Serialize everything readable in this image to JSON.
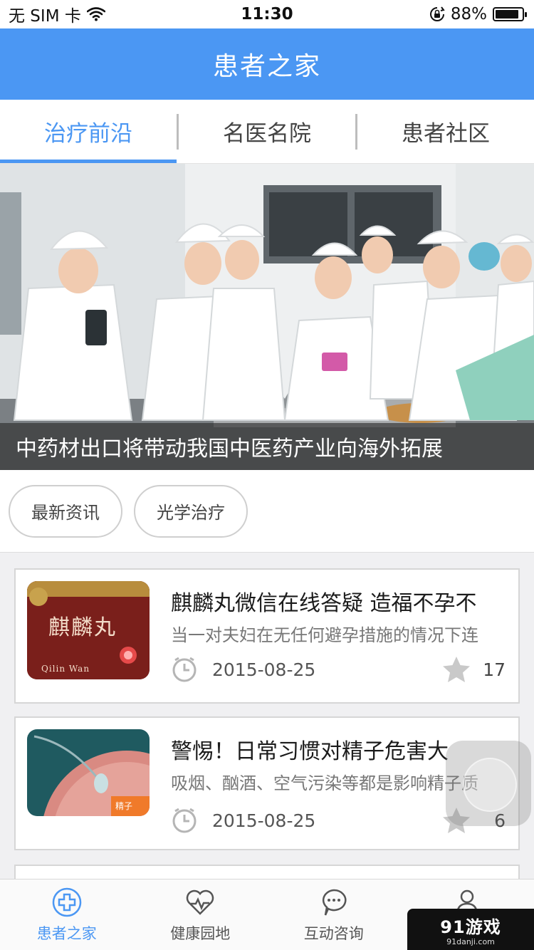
{
  "status_bar": {
    "carrier": "无 SIM 卡",
    "time": "11:30",
    "battery": "88%",
    "battery_level": 0.88
  },
  "nav": {
    "title": "患者之家"
  },
  "tabs": [
    {
      "label": "治疗前沿",
      "active": true
    },
    {
      "label": "名医名院",
      "active": false
    },
    {
      "label": "患者社区",
      "active": false
    }
  ],
  "banner": {
    "caption": "中药材出口将带动我国中医药产业向海外拓展"
  },
  "chips": [
    {
      "label": "最新资讯"
    },
    {
      "label": "光学治疗"
    }
  ],
  "articles": [
    {
      "title": "麒麟丸微信在线答疑 造福不孕不",
      "summary": "当一对夫妇在无任何避孕措施的情况下连",
      "date": "2015-08-25",
      "favorites": "17",
      "thumb_text_main": "麒麟丸",
      "thumb_text_sub": "Qilin Wan"
    },
    {
      "title": "警惕！日常习惯对精子危害大",
      "summary": "吸烟、酗酒、空气污染等都是影响精子质",
      "date": "2015-08-25",
      "favorites": "6",
      "thumb_tag": "精子"
    }
  ],
  "bottom_nav": [
    {
      "label": "患者之家",
      "icon": "medical-cross-icon",
      "active": true
    },
    {
      "label": "健康园地",
      "icon": "heart-pulse-icon",
      "active": false
    },
    {
      "label": "互动咨询",
      "icon": "chat-bubble-icon",
      "active": false
    },
    {
      "label": "",
      "icon": "user-icon",
      "active": false
    }
  ],
  "watermark": {
    "main": "91游戏",
    "sub": "91danji.com"
  },
  "colors": {
    "accent": "#4b97f3",
    "nav_bg": "#4b97f3"
  }
}
